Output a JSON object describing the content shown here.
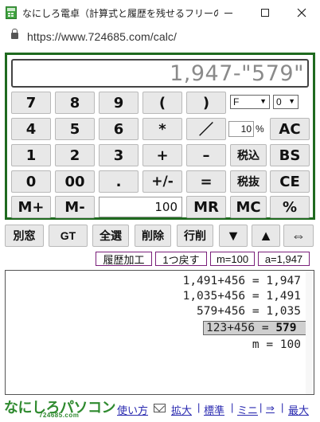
{
  "window": {
    "title": "なにしろ電卓（計算式と履歴を残せるフリーのウ...",
    "minimize_icon": "minimize-icon",
    "maximize_icon": "maximize-icon",
    "close_icon": "close-icon"
  },
  "address_bar": {
    "url": "https://www.724685.com/calc/",
    "lock_icon": "lock-icon"
  },
  "display": {
    "expression": "1,947-\"579\""
  },
  "keypad": {
    "rows": [
      [
        "7",
        "8",
        "9",
        "(",
        ")"
      ],
      [
        "4",
        "5",
        "6",
        "*",
        "／"
      ],
      [
        "1",
        "2",
        "3",
        "+",
        "–"
      ],
      [
        "0",
        "00",
        ".",
        "+/-",
        "="
      ]
    ],
    "m_plus": "M+",
    "m_minus": "M-",
    "memory_value": "100",
    "mr": "MR",
    "mc": "MC",
    "percent": "%",
    "format_select": "F",
    "decimal_select": "0",
    "tax_rate": "10",
    "tax_rate_unit": "%",
    "ac": "AC",
    "tax_in": "税込",
    "bs": "BS",
    "tax_out": "税抜",
    "ce": "CE"
  },
  "toolbar": {
    "separate_window": "別窓",
    "gt": "GT",
    "select_all": "全選",
    "delete": "削除",
    "delete_line": "行削",
    "down": "▼",
    "up": "▲",
    "swap": "⇔"
  },
  "tags": {
    "history_edit": "履歴加工",
    "undo": "1つ戻す",
    "memory_status": "m=100",
    "answer_status": "a=1,947"
  },
  "history": [
    {
      "expr": "1,491+456 = 1,947",
      "selected": false
    },
    {
      "expr": "1,035+456 = 1,491",
      "selected": false
    },
    {
      "expr": "579+456 = 1,035",
      "selected": false
    },
    {
      "expr_left": "123+456 = ",
      "expr_result": "579",
      "selected": true
    },
    {
      "expr": "m = 100",
      "selected": false
    }
  ],
  "footer": {
    "logo_text": "なにしろパソコン",
    "logo_sub": "724685.com",
    "links": [
      "使い方",
      "拡大",
      "標準",
      "ミニ",
      "⇒",
      "最大"
    ],
    "mail_icon": "mail-icon"
  },
  "colors": {
    "panel_border": "#1f6a1f",
    "tag_border": "#7a1f7a",
    "link": "#2a2ab0",
    "logo_green": "#2f8a2f"
  }
}
